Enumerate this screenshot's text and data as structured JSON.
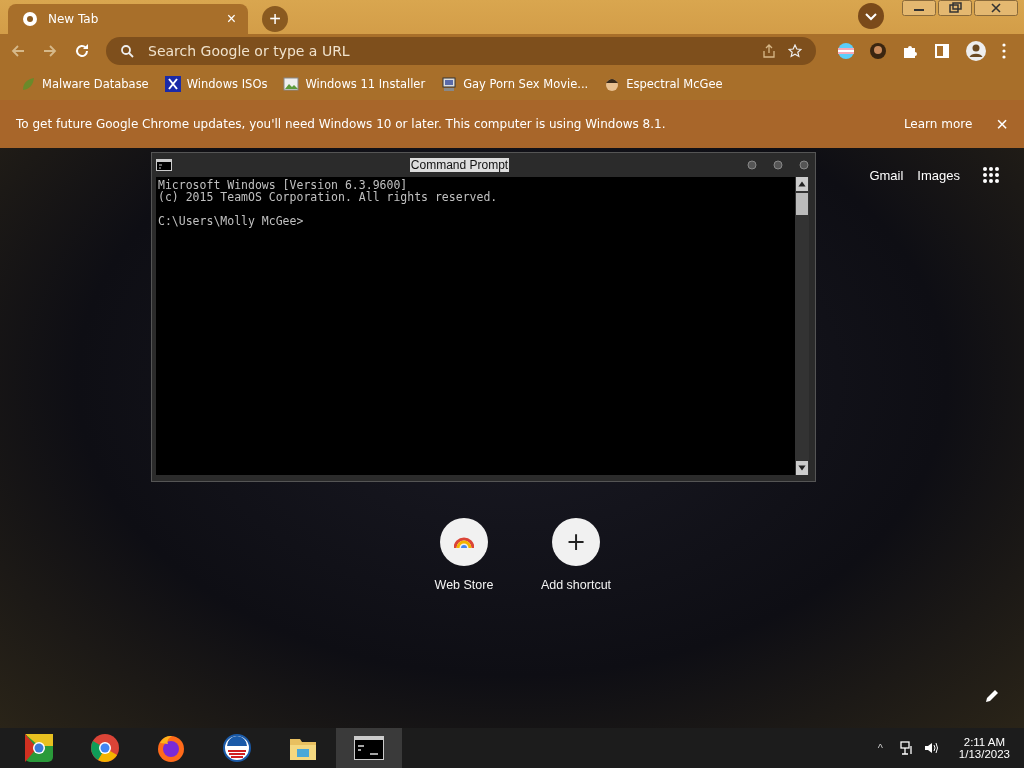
{
  "browser": {
    "tabs": [
      {
        "title": "New Tab",
        "close": "×",
        "selected": true
      }
    ],
    "new_tab": "+",
    "address_bar": {
      "placeholder": "Search Google or type a URL"
    },
    "bookmarks": [
      {
        "kind": "leaf",
        "label": "Malware Database"
      },
      {
        "kind": "x",
        "label": "Windows ISOs"
      },
      {
        "kind": "image",
        "label": "Windows 11 Installer"
      },
      {
        "kind": "computer",
        "label": "Gay Porn Sex Movie..."
      },
      {
        "kind": "face",
        "label": "Espectral McGee"
      }
    ],
    "infobar": {
      "message": "To get future Google Chrome updates, you'll need Windows 10 or later. This computer is using Windows 8.1.",
      "link": "Learn more",
      "close": "×"
    },
    "header_links": [
      "Gmail",
      "Images"
    ],
    "shortcuts": [
      {
        "kind": "webstore",
        "label": "Web Store"
      },
      {
        "kind": "add",
        "label": "Add shortcut",
        "symbol": "+"
      }
    ]
  },
  "console": {
    "title": "Command Prompt",
    "paragraphs": [
      [
        "Microsoft Windows [Version 6.3.9600]",
        "(c) 2015 TeamOS Corporation. All rights reserved."
      ],
      [
        "C:\\Users\\Molly McGee>"
      ]
    ]
  },
  "taskbar": {
    "apps": [
      {
        "kind": "canary",
        "selected": false
      },
      {
        "kind": "chrome",
        "selected": false
      },
      {
        "kind": "firefox",
        "selected": false
      },
      {
        "kind": "campaign",
        "selected": false
      },
      {
        "kind": "folder",
        "selected": false
      },
      {
        "kind": "console",
        "selected": true
      }
    ],
    "tray_arrow": "^",
    "time": "2:11 AM",
    "date": "1/13/2023"
  }
}
